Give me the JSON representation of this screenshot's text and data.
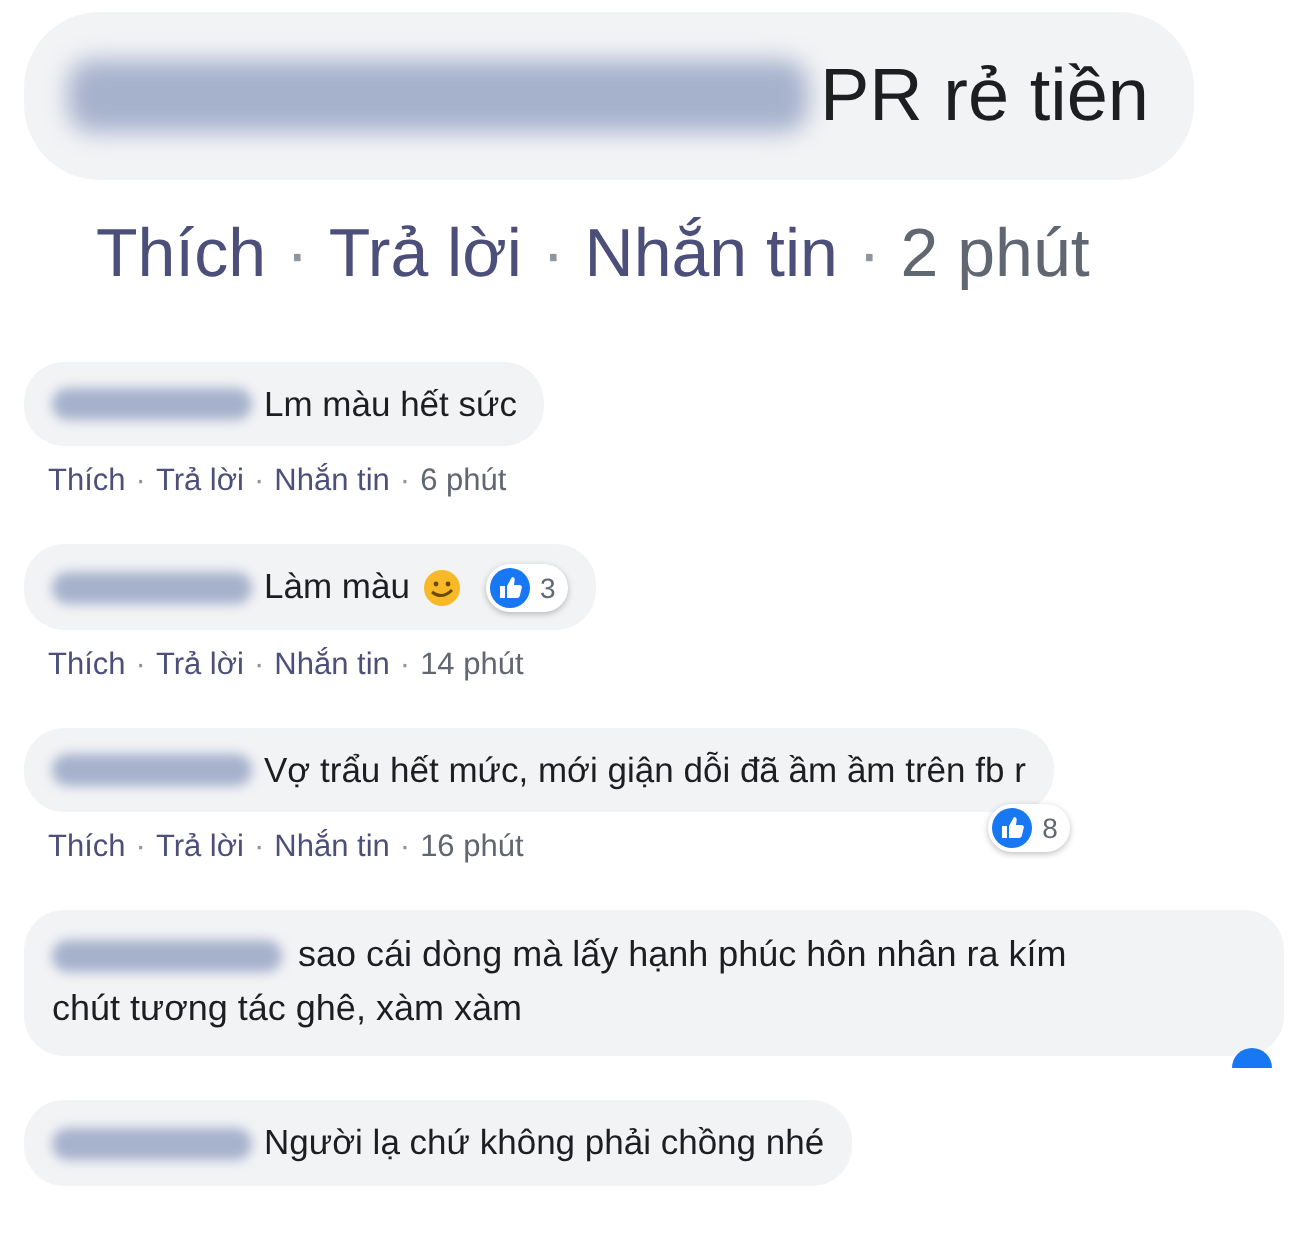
{
  "separator": "·",
  "comments": [
    {
      "kind": "zoomed",
      "text": "PR rẻ tiền",
      "actions": [
        "Thích",
        "Trả lời",
        "Nhắn tin"
      ],
      "time": "2 phút"
    },
    {
      "kind": "normal",
      "text": "Lm màu hết sức",
      "actions": [
        "Thích",
        "Trả lời",
        "Nhắn tin"
      ],
      "time": "6 phút"
    },
    {
      "kind": "normal",
      "text": "Làm màu",
      "emoji": true,
      "likes": "3",
      "likes_on_corner": false,
      "actions": [
        "Thích",
        "Trả lời",
        "Nhắn tin"
      ],
      "time": "14 phút"
    },
    {
      "kind": "normal",
      "text": "Vợ trẩu hết mức, mới giận dỗi đã ầm ầm trên fb r",
      "likes": "8",
      "likes_on_corner": true,
      "actions": [
        "Thích",
        "Trả lời",
        "Nhắn tin"
      ],
      "time": "16 phút"
    },
    {
      "kind": "wrapped",
      "lines": [
        "sao cái dòng mà lấy hạnh phúc hôn nhân ra kím",
        "chút tương tác ghê, xàm xàm"
      ],
      "like_cut": true
    },
    {
      "kind": "normal",
      "text": "Người lạ chứ không phải chồng nhé"
    }
  ]
}
